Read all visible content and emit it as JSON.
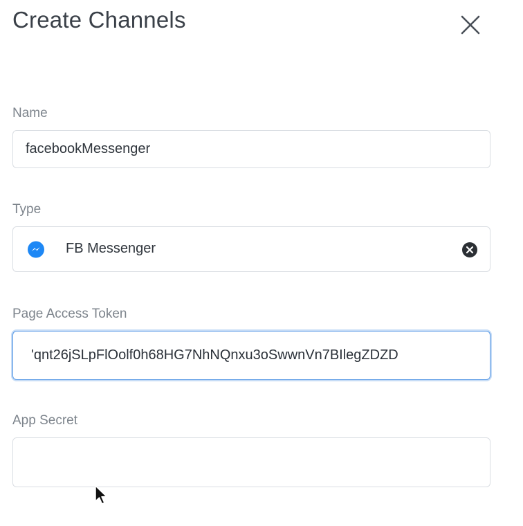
{
  "dialog": {
    "title": "Create Channels"
  },
  "fields": {
    "name": {
      "label": "Name",
      "value": "facebookMessenger"
    },
    "type": {
      "label": "Type",
      "value": "FB Messenger",
      "icon": "messenger-icon",
      "icon_color": "#1e88f5"
    },
    "page_access_token": {
      "label": "Page Access Token",
      "value": "'qnt26jSLpFlOolf0h68HG7NhNQnxu3oSwwnVn7BIlegZDZD"
    },
    "app_secret": {
      "label": "App Secret",
      "value": ""
    }
  },
  "colors": {
    "focus_border": "#5b9be6",
    "label": "#7d848c"
  }
}
